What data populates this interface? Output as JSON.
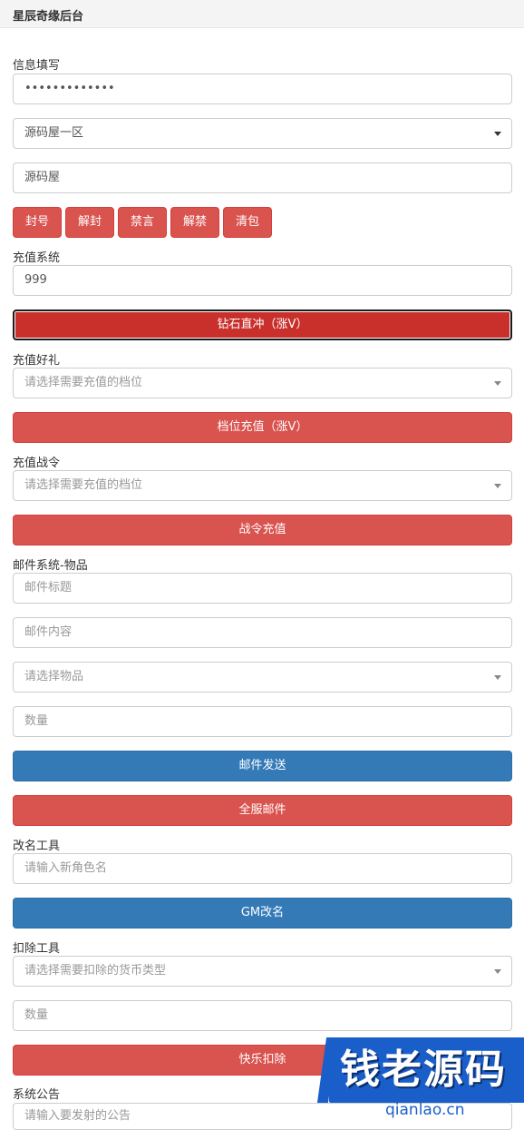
{
  "app": {
    "title": "星辰奇缘后台"
  },
  "info": {
    "label": "信息填写",
    "password": "•••••••••••••",
    "server_selected": "源码屋一区",
    "role_name": "源码屋",
    "actions": [
      "封号",
      "解封",
      "禁言",
      "解禁",
      "清包"
    ]
  },
  "recharge": {
    "label": "充值系统",
    "amount": "999",
    "button": "钻石直冲（涨V）"
  },
  "gift": {
    "label": "充值好礼",
    "placeholder": "请选择需要充值的档位",
    "button": "档位充值（涨V）"
  },
  "battle_pass": {
    "label": "充值战令",
    "placeholder": "请选择需要充值的档位",
    "button": "战令充值"
  },
  "mail": {
    "label": "邮件系统-物品",
    "title_placeholder": "邮件标题",
    "content_placeholder": "邮件内容",
    "item_placeholder": "请选择物品",
    "qty_placeholder": "数量",
    "send_button": "邮件发送",
    "all_button": "全服邮件"
  },
  "rename": {
    "label": "改名工具",
    "placeholder": "请输入新角色名",
    "button": "GM改名"
  },
  "deduct": {
    "label": "扣除工具",
    "type_placeholder": "请选择需要扣除的货币类型",
    "qty_placeholder": "数量",
    "button": "快乐扣除"
  },
  "announce": {
    "label": "系统公告",
    "placeholder": "请输入要发射的公告"
  },
  "watermark": {
    "text": "钱老源码",
    "url": "qianlao.cn"
  },
  "colors": {
    "danger": "#d9534f",
    "danger_active": "#c9302c",
    "primary": "#337ab7",
    "watermark_blue": "#1a5fc9"
  }
}
